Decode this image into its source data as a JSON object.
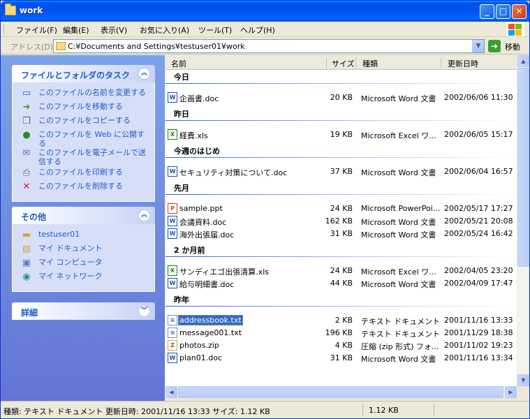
{
  "window": {
    "title": "work"
  },
  "menu": {
    "items": [
      "ファイル(F)",
      "編集(E)",
      "表示(V)",
      "お気に入り(A)",
      "ツール(T)",
      "ヘルプ(H)"
    ]
  },
  "address": {
    "label": "アドレス(D)",
    "path": "C:¥Documents and Settings¥testuser01¥work",
    "go_label": "移動"
  },
  "tasks": {
    "file_folder": {
      "title": "ファイルとフォルダのタスク",
      "items": [
        {
          "label": "このファイルの名前を変更する",
          "icon": "rename-icon"
        },
        {
          "label": "このファイルを移動する",
          "icon": "move-icon"
        },
        {
          "label": "このファイルをコピーする",
          "icon": "copy-icon"
        },
        {
          "label": "このファイルを Web に公開する",
          "icon": "web-publish-icon"
        },
        {
          "label": "このファイルを電子メールで送信する",
          "icon": "email-icon"
        },
        {
          "label": "このファイルを印刷する",
          "icon": "print-icon"
        },
        {
          "label": "このファイルを削除する",
          "icon": "delete-icon"
        }
      ]
    },
    "other": {
      "title": "その他",
      "items": [
        {
          "label": "testuser01",
          "icon": "folder-icon"
        },
        {
          "label": "マイ ドキュメント",
          "icon": "my-documents-icon"
        },
        {
          "label": "マイ コンピュータ",
          "icon": "my-computer-icon"
        },
        {
          "label": "マイ ネットワーク",
          "icon": "my-network-icon"
        }
      ]
    },
    "details": {
      "title": "詳細"
    }
  },
  "columns": {
    "name": "名前",
    "size": "サイズ",
    "type": "種類",
    "modified": "更新日時"
  },
  "groups": [
    {
      "title": "今日",
      "files": [
        {
          "name": "企画書.doc",
          "icon": "word",
          "size": "20 KB",
          "type": "Microsoft Word 文書",
          "date": "2002/06/06 11:30"
        }
      ]
    },
    {
      "title": "昨日",
      "files": [
        {
          "name": "経費.xls",
          "icon": "excel",
          "size": "19 KB",
          "type": "Microsoft Excel ワ...",
          "date": "2002/06/05 15:17"
        }
      ]
    },
    {
      "title": "今週のはじめ",
      "files": [
        {
          "name": "セキュリティ対策について.doc",
          "icon": "word",
          "size": "37 KB",
          "type": "Microsoft Word 文書",
          "date": "2002/06/04 16:57"
        }
      ]
    },
    {
      "title": "先月",
      "files": [
        {
          "name": "sample.ppt",
          "icon": "ppt",
          "size": "24 KB",
          "type": "Microsoft PowerPoi...",
          "date": "2002/05/17 17:27"
        },
        {
          "name": "会議資料.doc",
          "icon": "word",
          "size": "162 KB",
          "type": "Microsoft Word 文書",
          "date": "2002/05/21 20:08"
        },
        {
          "name": "海外出張届.doc",
          "icon": "word",
          "size": "31 KB",
          "type": "Microsoft Word 文書",
          "date": "2002/05/24 16:42"
        }
      ]
    },
    {
      "title": "2 か月前",
      "files": [
        {
          "name": "サンディエゴ出張清算.xls",
          "icon": "excel",
          "size": "24 KB",
          "type": "Microsoft Excel ワ...",
          "date": "2002/04/05 23:20"
        },
        {
          "name": "給与明細書.doc",
          "icon": "word",
          "size": "44 KB",
          "type": "Microsoft Word 文書",
          "date": "2002/04/09 17:47"
        }
      ]
    },
    {
      "title": "昨年",
      "files": [
        {
          "name": "addressbook.txt",
          "icon": "text",
          "size": "2 KB",
          "type": "テキスト ドキュメント",
          "date": "2001/11/16 13:33",
          "selected": true
        },
        {
          "name": "message001.txt",
          "icon": "text",
          "size": "196 KB",
          "type": "テキスト ドキュメント",
          "date": "2001/11/29 18:38"
        },
        {
          "name": "photos.zip",
          "icon": "zip",
          "size": "4 KB",
          "type": "圧縮 (zip 形式) フォ...",
          "date": "2001/11/02 19:23"
        },
        {
          "name": "plan01.doc",
          "icon": "word",
          "size": "31 KB",
          "type": "Microsoft Word 文書",
          "date": "2001/11/16 13:34"
        }
      ]
    }
  ],
  "status": {
    "text": "種類: テキスト ドキュメント 更新日時: 2001/11/16 13:33 サイズ: 1.12 KB",
    "size": "1.12 KB"
  }
}
